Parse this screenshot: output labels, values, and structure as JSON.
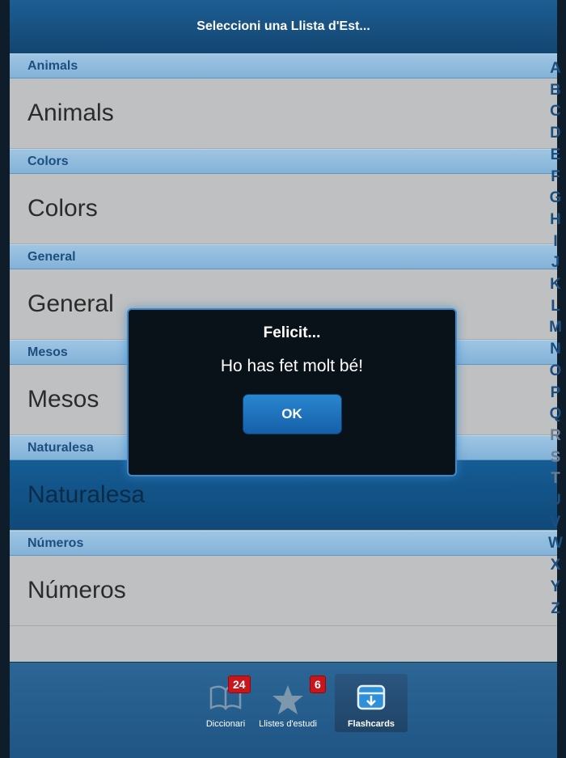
{
  "header": {
    "title": "Seleccioni una Llista d'Est..."
  },
  "sections": [
    {
      "header": "Animals",
      "item": "Animals",
      "selected": false
    },
    {
      "header": "Colors",
      "item": "Colors",
      "selected": false
    },
    {
      "header": "General",
      "item": "General",
      "selected": false
    },
    {
      "header": "Mesos",
      "item": "Mesos",
      "selected": false
    },
    {
      "header": "Naturalesa",
      "item": "Naturalesa",
      "selected": true
    },
    {
      "header": "Números",
      "item": "Números",
      "selected": false
    }
  ],
  "alphabet": [
    "A",
    "B",
    "C",
    "D",
    "E",
    "F",
    "G",
    "H",
    "I",
    "J",
    "K",
    "L",
    "M",
    "N",
    "O",
    "P",
    "Q",
    "R",
    "S",
    "T",
    "U",
    "V",
    "W",
    "X",
    "Y",
    "Z"
  ],
  "alphabet_dimmed": [
    "R",
    "S",
    "T"
  ],
  "dialog": {
    "title": "Felicit...",
    "message": "Ho has fet molt bé!",
    "ok_label": "OK"
  },
  "tabs": [
    {
      "label": "Diccionari",
      "badge": "24",
      "icon": "book-icon",
      "active": false
    },
    {
      "label": "Llistes d'estudi",
      "badge": "6",
      "icon": "star-icon",
      "active": false
    },
    {
      "label": "Flashcards",
      "badge": "",
      "icon": "archive-box-icon",
      "active": true
    }
  ],
  "colors": {
    "accent": "#1d5e93",
    "badge": "#c8161a",
    "selected_row": "#155c95"
  }
}
